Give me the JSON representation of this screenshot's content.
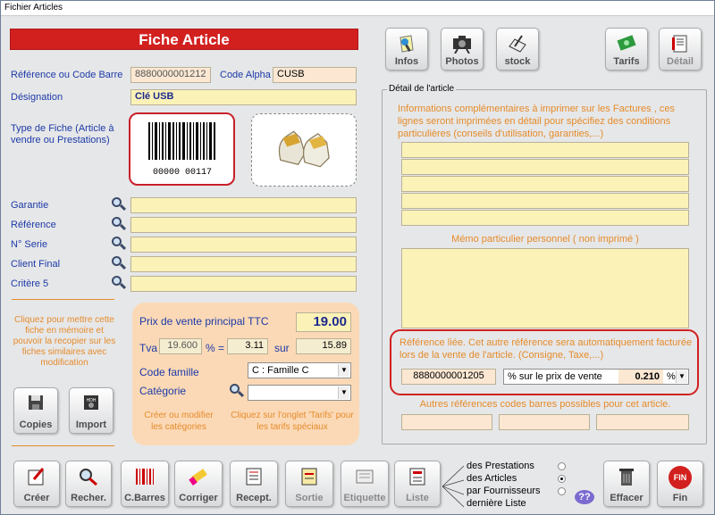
{
  "window": {
    "title": "Fichier Articles"
  },
  "header": {
    "title": "Fiche Article"
  },
  "toolbar_top": [
    {
      "label": "Infos",
      "icon": "infos-icon"
    },
    {
      "label": "Photos",
      "icon": "camera-icon"
    },
    {
      "label": "stock",
      "icon": "stock-icon"
    },
    {
      "label": "Tarifs",
      "icon": "tarifs-icon"
    },
    {
      "label": "Détail",
      "icon": "detail-icon"
    }
  ],
  "form": {
    "reference_label": "Référence ou Code Barre",
    "reference_value": "8880000001212",
    "code_alpha_label": "Code Alpha",
    "code_alpha_value": "CUSB",
    "designation_label": "Désignation",
    "designation_value": "Clé USB",
    "type_fiche_label": "Type de Fiche (Article à vendre ou Prestations)",
    "barcode_text": "00000 00117",
    "fields": [
      {
        "label": "Garantie",
        "value": ""
      },
      {
        "label": "Référence",
        "value": ""
      },
      {
        "label": "N° Serie",
        "value": ""
      },
      {
        "label": "Client Final",
        "value": ""
      },
      {
        "label": "Critère 5",
        "value": ""
      }
    ]
  },
  "memo_hint": "Cliquez pour mettre cette fiche en mémoire et pouvoir la recopier sur les fiches similaires avec modification",
  "copies": {
    "label": "Copies"
  },
  "import": {
    "label": "Import"
  },
  "price": {
    "title": "Prix de vente principal TTC",
    "value": "19.00",
    "tva_label": "Tva",
    "tva_value": "19.600",
    "percent_label": "% =",
    "tva_amount": "3.11",
    "sur_label": "sur",
    "ht_value": "15.89",
    "famille_label": "Code famille",
    "famille_value": "C : Famille C",
    "categorie_label": "Catégorie",
    "categorie_value": "",
    "hint_left": "Créer ou modifier les catégories",
    "hint_right": "Cliquez sur l'onglet 'Tarifs' pour les tarifs spéciaux"
  },
  "detail": {
    "group_label": "Détail de l'article",
    "info_text": "Informations complémentaires à imprimer sur les Factures , ces lignes seront imprimées en détail pour spécifiez des conditions particulières (conseils d'utilisation, garanties,...)",
    "memo_title": "Mémo particulier personnel ( non imprimé )",
    "linked_text": "Référence liée. Cet autre référence sera automatiquement facturée lors de la vente de l'article. (Consigne,  Taxe,...)",
    "linked_ref": "8880000001205",
    "linked_mode": "% sur le prix de vente",
    "linked_value": "0.210",
    "linked_unit": "%",
    "other_barcodes": "Autres références codes barres possibles pour cet article."
  },
  "toolbar_bottom": [
    {
      "label": "Créer",
      "icon": "create-icon"
    },
    {
      "label": "Recher.",
      "icon": "search-icon"
    },
    {
      "label": "C.Barres",
      "icon": "barcode-icon"
    },
    {
      "label": "Corriger",
      "icon": "eraser-icon"
    },
    {
      "label": "Recept.",
      "icon": "reception-icon"
    },
    {
      "label": "Sortie",
      "icon": "exit-goods-icon"
    },
    {
      "label": "Etiquette",
      "icon": "label-icon"
    },
    {
      "label": "Liste",
      "icon": "list-icon"
    }
  ],
  "list_options": [
    {
      "label": "des Prestations",
      "selected": false
    },
    {
      "label": "des Articles",
      "selected": true
    },
    {
      "label": "par Fournisseurs",
      "selected": false
    },
    {
      "label": "dernière Liste",
      "selected": false
    }
  ],
  "effacer": {
    "label": "Effacer"
  },
  "fin": {
    "label": "Fin",
    "badge": "FIN"
  },
  "colors": {
    "accent_red": "#d2201f",
    "orange": "#e58b2b",
    "field_yellow": "#fbf2b8",
    "label_blue": "#1c3aa8"
  }
}
